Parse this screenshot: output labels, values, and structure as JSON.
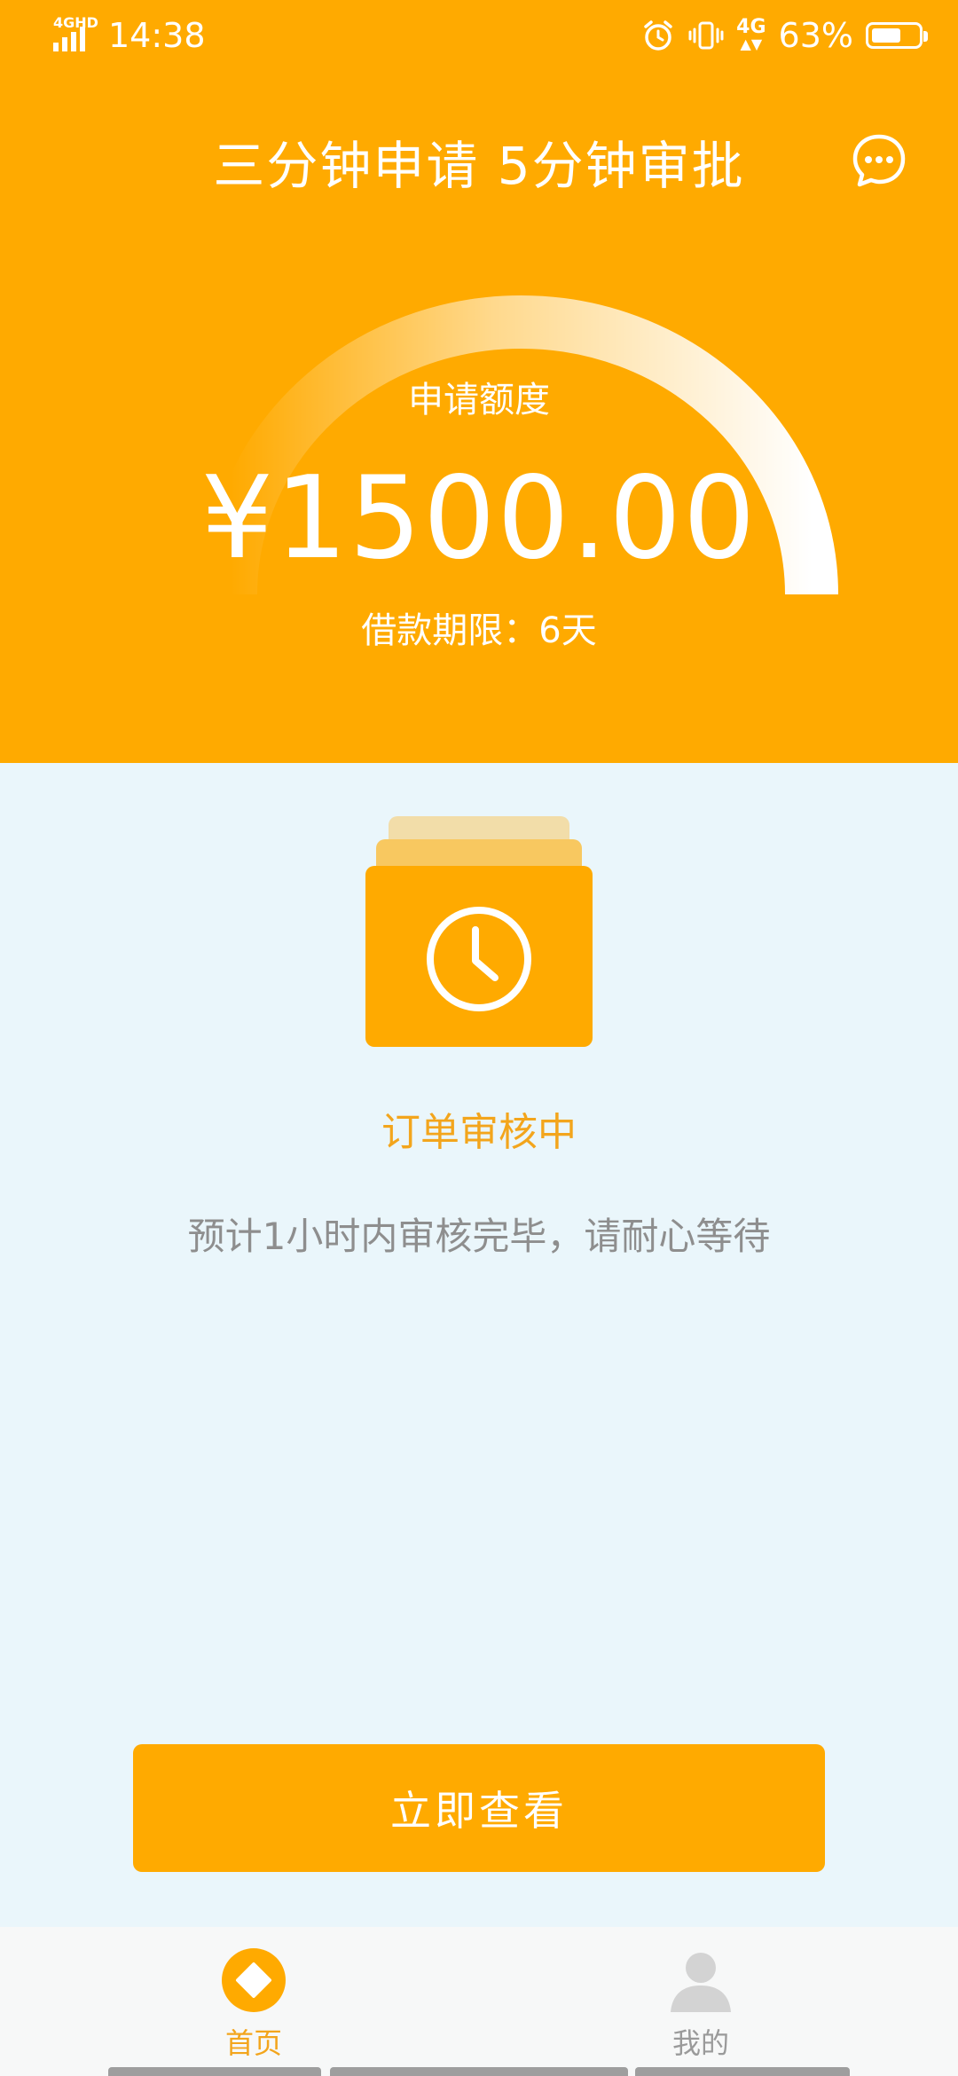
{
  "status_bar": {
    "network_tag": "4GHD",
    "time": "14:38",
    "network_right": "4G",
    "battery_percent": "63%",
    "battery_level": 0.63
  },
  "header": {
    "title": "三分钟申请 5分钟审批",
    "chat_icon": "chat-bubble-icon"
  },
  "credit": {
    "label": "申请额度",
    "amount": "¥1500.00",
    "term": "借款期限：6天"
  },
  "order_status": {
    "icon": "clock-icon",
    "title": "订单审核中",
    "description": "预计1小时内审核完毕，请耐心等待"
  },
  "action": {
    "button_label": "立即查看"
  },
  "tabbar": {
    "items": [
      {
        "label": "首页",
        "icon": "home-diamond-icon",
        "active": true
      },
      {
        "label": "我的",
        "icon": "user-icon",
        "active": false
      }
    ]
  },
  "colors": {
    "brand": "#FFAA00",
    "status_text": "#F3A51C",
    "background": "#EAF6FB",
    "muted_text": "#8E8E8E"
  }
}
